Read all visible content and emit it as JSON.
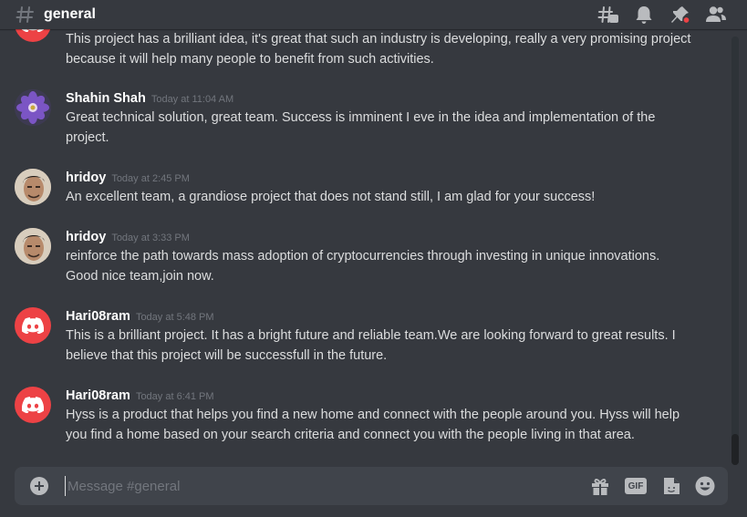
{
  "header": {
    "channel_name": "general",
    "icons": [
      "hashtag-threads-icon",
      "bell-icon",
      "pin-icon",
      "members-icon"
    ],
    "pin_badge_color": "#ed4245"
  },
  "messages": [
    {
      "avatar": "discord-icon",
      "username": "",
      "timestamp": "",
      "text": "This project has a brilliant idea, it's great that such an industry is developing, really a very promising project because it will help many people to benefit from such activities."
    },
    {
      "avatar": "flower-avatar",
      "username": "Shahin Shah",
      "timestamp": "Today at 11:04 AM",
      "text": "Great technical solution, great team. Success is imminent I eve in the idea and implementation of the project."
    },
    {
      "avatar": "person-avatar",
      "username": "hridoy",
      "timestamp": "Today at 2:45 PM",
      "text": "An excellent team, a grandiose project that does not stand still, I am glad for your success!"
    },
    {
      "avatar": "person-avatar",
      "username": "hridoy",
      "timestamp": "Today at 3:33 PM",
      "text": "reinforce the path towards mass adoption of cryptocurrencies through investing in unique innovations. Good nice team,join now."
    },
    {
      "avatar": "discord-icon",
      "username": "Hari08ram",
      "timestamp": "Today at 5:48 PM",
      "text": "This is a brilliant project. It has a bright future and reliable team.We are looking forward to great results. I believe that this project will be successfull in the future."
    },
    {
      "avatar": "discord-icon",
      "username": "Hari08ram",
      "timestamp": "Today at 6:41 PM",
      "text": "Hyss is a product that helps you find a new home and connect with the people around you. Hyss will help you find a home based on your search criteria and connect you with the people living in that area."
    }
  ],
  "composer": {
    "placeholder": "Message #general",
    "gif_label": "GIF",
    "icons": [
      "add-attachment-icon",
      "gift-icon",
      "gif-icon",
      "sticker-icon",
      "emoji-icon"
    ]
  },
  "colors": {
    "background": "#36393f",
    "discord_red": "#ed4245",
    "text": "#dcddde",
    "muted": "#72767d"
  }
}
